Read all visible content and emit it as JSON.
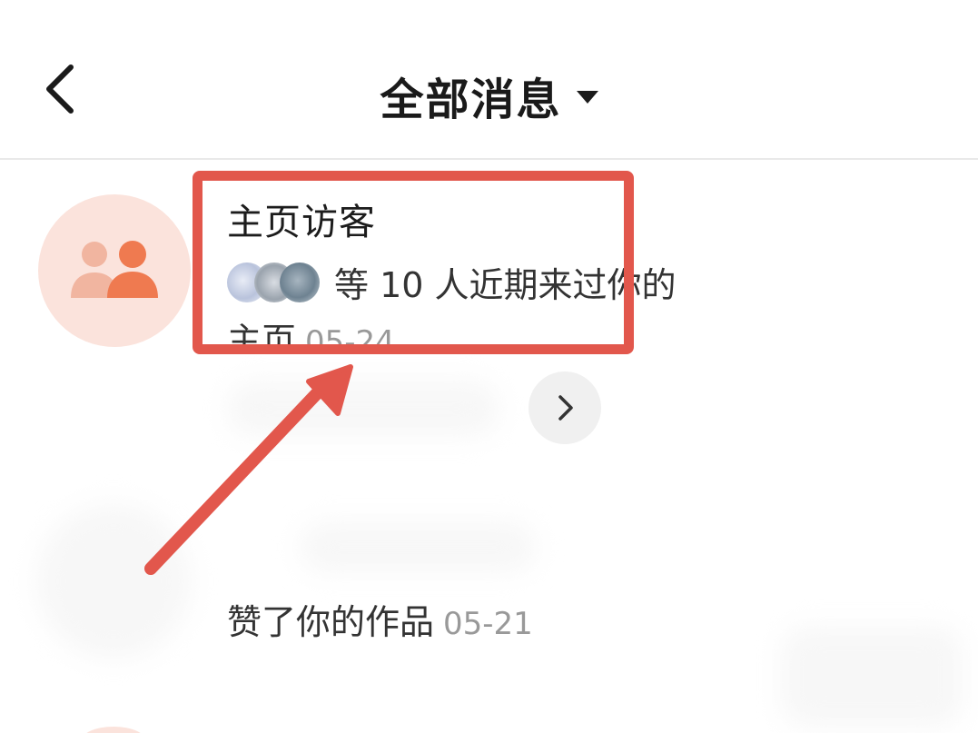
{
  "header": {
    "title": "全部消息",
    "back_icon": "chevron-left-icon",
    "dropdown_icon": "caret-down-icon"
  },
  "visitor": {
    "title": "主页访客",
    "summary": "等 10 人近期来过你的",
    "summary_cont": "主页",
    "date": "05-24",
    "icon": "users-icon"
  },
  "expand": {
    "icon": "chevron-right-icon"
  },
  "like": {
    "text": "赞了你的作品",
    "date": "05-21"
  },
  "colors": {
    "accent": "#e2574c",
    "avatar_bg": "#fbe3dc",
    "user_icon_front": "#ef7a50",
    "user_icon_back": "#f1b5a0"
  }
}
